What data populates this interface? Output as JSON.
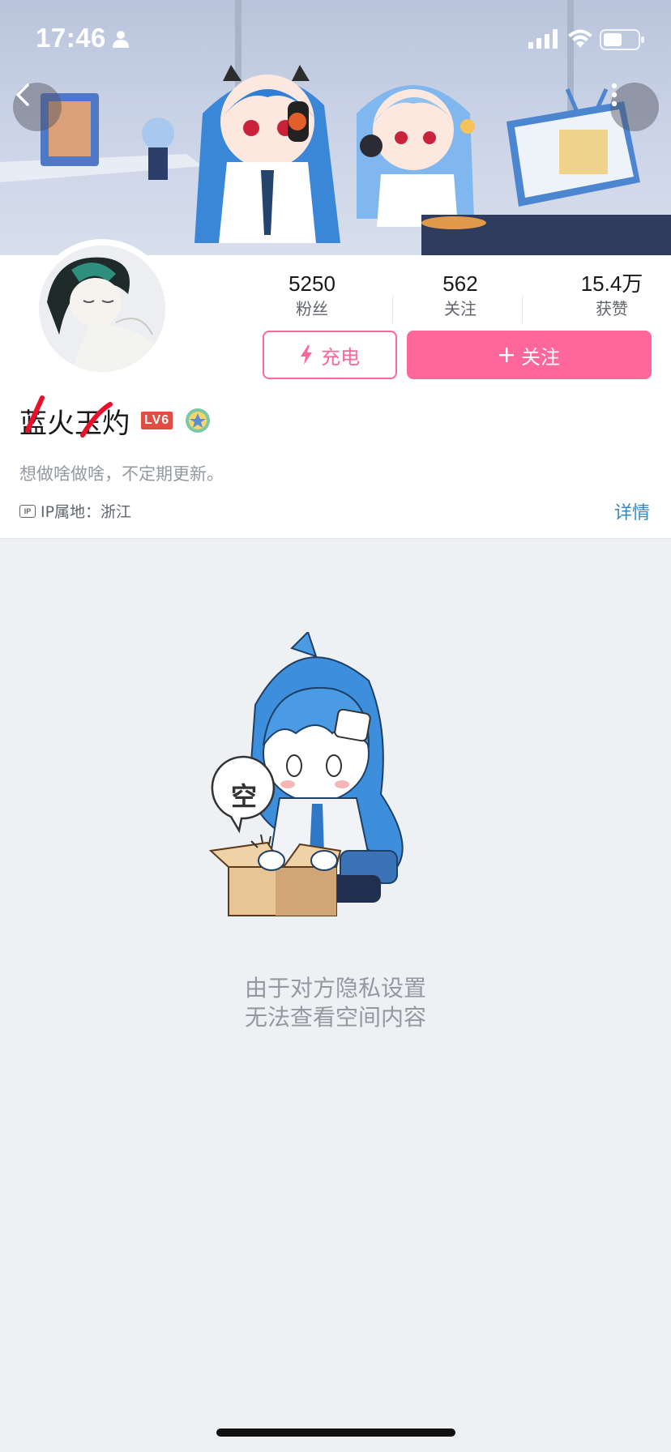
{
  "status_bar": {
    "time": "17:46",
    "icons": [
      "person-icon",
      "signal-icon",
      "wifi-icon",
      "battery-icon"
    ]
  },
  "header": {
    "back_icon": "chevron-left-icon",
    "more_icon": "more-vertical-icon"
  },
  "profile": {
    "stats": [
      {
        "value": "5250",
        "label": "粉丝"
      },
      {
        "value": "562",
        "label": "关注"
      },
      {
        "value": "15.4万",
        "label": "获赞"
      }
    ],
    "charge_button": "充电",
    "follow_button": "关注",
    "username": "蓝火玉灼",
    "level": "LV6",
    "bio": "想做啥做啥，不定期更新。",
    "ip_label": "IP属地：浙江",
    "ip_badge": "IP",
    "details_link": "详情"
  },
  "empty_state": {
    "bubble_text": "空",
    "line1": "由于对方隐私设置",
    "line2": "无法查看空间内容"
  },
  "colors": {
    "accent": "#ff6699",
    "link": "#2f8ac5",
    "level_badge": "#e24d43",
    "background": "#eef1f4"
  }
}
